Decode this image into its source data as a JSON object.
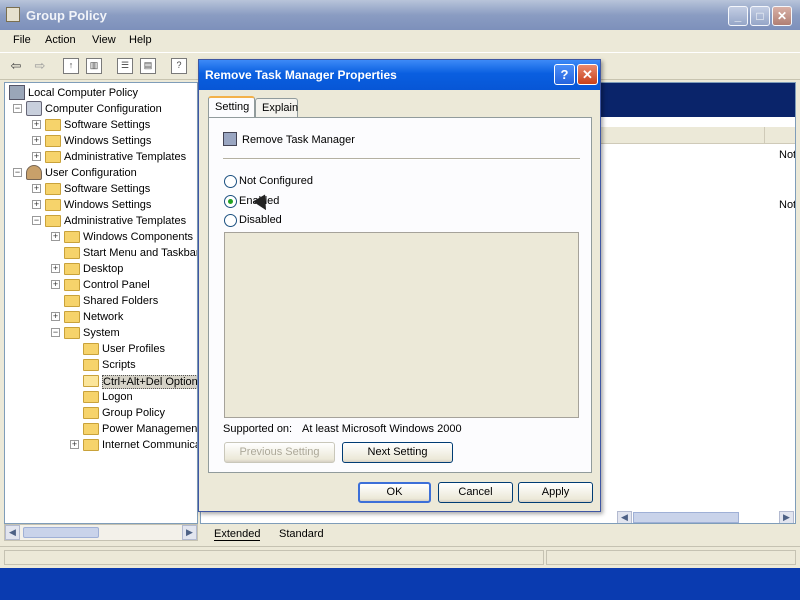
{
  "main_window": {
    "title": "Group Policy",
    "menu": [
      "File",
      "Action",
      "View",
      "Help"
    ],
    "tree": [
      {
        "label": "Local Computer Policy",
        "level": 0,
        "icon": "policy-icon"
      },
      {
        "label": "Computer Configuration",
        "level": 1,
        "icon": "computer-icon",
        "expander": "-"
      },
      {
        "label": "Software Settings",
        "level": 2,
        "icon": "folder-icon",
        "expander": "+"
      },
      {
        "label": "Windows Settings",
        "level": 2,
        "icon": "folder-icon",
        "expander": "+"
      },
      {
        "label": "Administrative Templates",
        "level": 2,
        "icon": "folder-icon",
        "expander": "+"
      },
      {
        "label": "User Configuration",
        "level": 1,
        "icon": "user-icon",
        "expander": "-"
      },
      {
        "label": "Software Settings",
        "level": 2,
        "icon": "folder-icon",
        "expander": "+"
      },
      {
        "label": "Windows Settings",
        "level": 2,
        "icon": "folder-icon",
        "expander": "+"
      },
      {
        "label": "Administrative Templates",
        "level": 2,
        "icon": "folder-icon",
        "expander": "-"
      },
      {
        "label": "Windows Components",
        "level": 3,
        "icon": "folder-icon",
        "expander": "+"
      },
      {
        "label": "Start Menu and Taskbar",
        "level": 3,
        "icon": "folder-icon",
        "expander": ""
      },
      {
        "label": "Desktop",
        "level": 3,
        "icon": "folder-icon",
        "expander": "+"
      },
      {
        "label": "Control Panel",
        "level": 3,
        "icon": "folder-icon",
        "expander": "+"
      },
      {
        "label": "Shared Folders",
        "level": 3,
        "icon": "folder-icon",
        "expander": ""
      },
      {
        "label": "Network",
        "level": 3,
        "icon": "folder-icon",
        "expander": "+"
      },
      {
        "label": "System",
        "level": 3,
        "icon": "folder-icon",
        "expander": "-"
      },
      {
        "label": "User Profiles",
        "level": 4,
        "icon": "folder-icon",
        "expander": ""
      },
      {
        "label": "Scripts",
        "level": 4,
        "icon": "folder-icon",
        "expander": ""
      },
      {
        "label": "Ctrl+Alt+Del Options",
        "level": 4,
        "icon": "folder-open-icon",
        "expander": "",
        "selected": true
      },
      {
        "label": "Logon",
        "level": 4,
        "icon": "folder-icon",
        "expander": ""
      },
      {
        "label": "Group Policy",
        "level": 4,
        "icon": "folder-icon",
        "expander": ""
      },
      {
        "label": "Power Management",
        "level": 4,
        "icon": "folder-icon",
        "expander": ""
      },
      {
        "label": "Internet Communication",
        "level": 4,
        "icon": "folder-icon",
        "expander": "+"
      }
    ],
    "right_pane": {
      "state_col_1": "Not",
      "state_col_2": "Not"
    },
    "view_tabs": [
      "Extended",
      "Standard"
    ]
  },
  "dialog": {
    "title": "Remove Task Manager Properties",
    "tabs": [
      "Setting",
      "Explain"
    ],
    "policy_name": "Remove Task Manager",
    "options": [
      {
        "label": "Not Configured",
        "checked": false
      },
      {
        "label": "Enabled",
        "checked": true
      },
      {
        "label": "Disabled",
        "checked": false
      }
    ],
    "supported_label": "Supported on:",
    "supported_value": "At least Microsoft Windows 2000",
    "previous_button": "Previous Setting",
    "next_button": "Next Setting",
    "ok_button": "OK",
    "cancel_button": "Cancel",
    "apply_button": "Apply"
  },
  "colors": {
    "dialog_title": "#0756d6",
    "selection_band": "#0a246a"
  }
}
